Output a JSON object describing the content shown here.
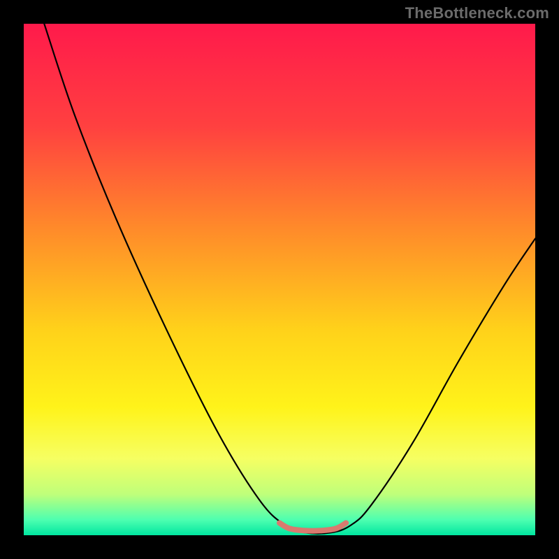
{
  "attribution": "TheBottleneck.com",
  "chart_data": {
    "type": "line",
    "title": "",
    "xlabel": "",
    "ylabel": "",
    "xlim": [
      0,
      100
    ],
    "ylim": [
      0,
      100
    ],
    "background_gradient": {
      "stops": [
        {
          "offset": 0,
          "color": "#ff1a4b"
        },
        {
          "offset": 20,
          "color": "#ff4040"
        },
        {
          "offset": 40,
          "color": "#ff8a2a"
        },
        {
          "offset": 60,
          "color": "#ffd21a"
        },
        {
          "offset": 75,
          "color": "#fff31a"
        },
        {
          "offset": 85,
          "color": "#f6ff62"
        },
        {
          "offset": 92,
          "color": "#bfff7a"
        },
        {
          "offset": 97,
          "color": "#4dffb0"
        },
        {
          "offset": 100,
          "color": "#00e6a0"
        }
      ]
    },
    "series": [
      {
        "name": "bottleneck-curve",
        "color": "#000000",
        "width": 2.2,
        "points": [
          {
            "x": 4,
            "y": 100
          },
          {
            "x": 10,
            "y": 82
          },
          {
            "x": 18,
            "y": 62
          },
          {
            "x": 28,
            "y": 40
          },
          {
            "x": 38,
            "y": 20
          },
          {
            "x": 46,
            "y": 7
          },
          {
            "x": 51,
            "y": 2
          },
          {
            "x": 55,
            "y": 0.5
          },
          {
            "x": 60,
            "y": 0.5
          },
          {
            "x": 64,
            "y": 2
          },
          {
            "x": 68,
            "y": 6
          },
          {
            "x": 76,
            "y": 18
          },
          {
            "x": 85,
            "y": 34
          },
          {
            "x": 94,
            "y": 49
          },
          {
            "x": 100,
            "y": 58
          }
        ]
      },
      {
        "name": "optimal-zone-marker",
        "color": "#d87a6f",
        "width": 8,
        "points": [
          {
            "x": 50,
            "y": 2.4
          },
          {
            "x": 52,
            "y": 1.3
          },
          {
            "x": 55,
            "y": 0.9
          },
          {
            "x": 58,
            "y": 0.9
          },
          {
            "x": 61,
            "y": 1.3
          },
          {
            "x": 63,
            "y": 2.4
          }
        ]
      }
    ]
  }
}
